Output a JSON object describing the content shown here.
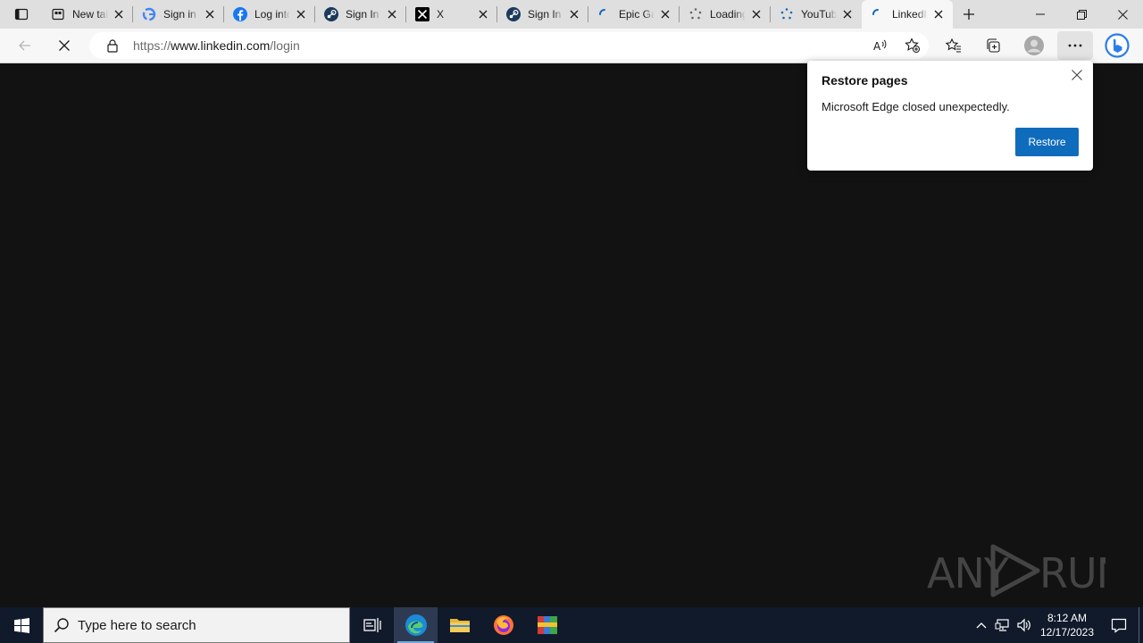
{
  "tabs": [
    {
      "title": "New tab",
      "icon": "new-tab-icon"
    },
    {
      "title": "Sign in",
      "icon": "google-icon"
    },
    {
      "title": "Log into Facebook",
      "icon": "facebook-icon"
    },
    {
      "title": "Sign In",
      "icon": "steam-icon"
    },
    {
      "title": "X",
      "icon": "x-icon"
    },
    {
      "title": "Sign In",
      "icon": "steam-icon"
    },
    {
      "title": "Epic Games",
      "icon": "loading-spinner-icon"
    },
    {
      "title": "Loading",
      "icon": "loading-dots-icon"
    },
    {
      "title": "YouTube",
      "icon": "loading-dots-icon"
    },
    {
      "title": "LinkedIn",
      "icon": "loading-spinner-icon"
    }
  ],
  "address": {
    "url_prefix": "https://",
    "url_host": "www.linkedin.com",
    "url_path": "/login"
  },
  "popup": {
    "title": "Restore pages",
    "message": "Microsoft Edge closed unexpectedly.",
    "button": "Restore"
  },
  "taskbar": {
    "search_placeholder": "Type here to search",
    "time": "8:12 AM",
    "date": "12/17/2023"
  },
  "watermark": {
    "text_left": "ANY",
    "text_right": "RUN"
  },
  "colors": {
    "accent": "#0f6cbd",
    "page_bg": "#121212",
    "taskbar": "#111a2b"
  }
}
